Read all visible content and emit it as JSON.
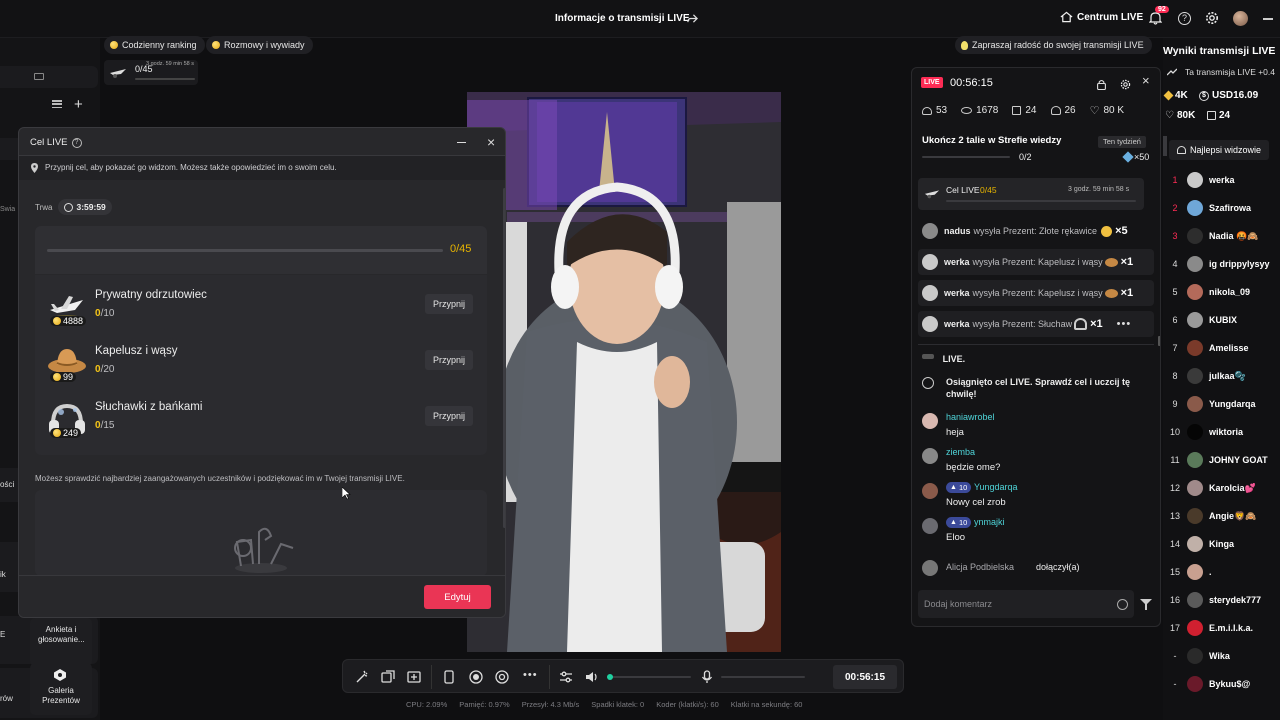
{
  "topbar": {
    "title": "Informacje o transmisji LIVE",
    "live_center": "Centrum LIVE",
    "notif_count": "92"
  },
  "chips": {
    "ranking": "Codzienny ranking",
    "interviews": "Rozmowy i wywiady",
    "invite": "Zapraszaj radość do swojej transmisji LIVE"
  },
  "mini_goal": {
    "progress": "0/45",
    "time": "3 godz. 59 min 58 s"
  },
  "left": {
    "partial_1": "Swia",
    "partial_2": "ości",
    "partial_3": "ik",
    "partial_4": "E",
    "partial_5": "rów",
    "poll_label": "Ankieta i głosowanie...",
    "gallery_label": "Galeria Prezentów"
  },
  "modal": {
    "title": "Cel LIVE",
    "info": "Przypnij cel, aby pokazać go widzom. Możesz także opowiedzieć im o swoim celu.",
    "duration_label": "Trwa",
    "duration_value": "3:59:59",
    "total_progress": "0/45",
    "gifts": [
      {
        "name": "Prywatny odrzutowiec",
        "price": "4888",
        "done": "0",
        "target": "/10",
        "pin": "Przypnij"
      },
      {
        "name": "Kapelusz i wąsy",
        "price": "99",
        "done": "0",
        "target": "/20",
        "pin": "Przypnij"
      },
      {
        "name": "Słuchawki z bańkami",
        "price": "249",
        "done": "0",
        "target": "/15",
        "pin": "Przypnij"
      }
    ],
    "footer_text": "Możesz sprawdzić najbardziej zaangażowanych uczestników i podziękować im w Twojej transmisji LIVE.",
    "edit_button": "Edytuj"
  },
  "panel": {
    "live_badge": "LIVE",
    "timer": "00:56:15",
    "stats": {
      "a": "53",
      "viewers": "1678",
      "c": "24",
      "d": "26",
      "likes": "80 K"
    },
    "quest_title": "Ukończ 2 talie w Strefie wiedzy",
    "quest_period": "Ten tydzień",
    "quest_progress": "0/2",
    "quest_reward": "×50",
    "goal_label": "Cel LIVE",
    "goal_progress": "0/45",
    "goal_time": "3 godz. 59 min 58 s",
    "gift_msgs": [
      {
        "user": "nadus",
        "text": "wysyła Prezent: Złote rękawice",
        "count": "×5"
      },
      {
        "user": "werka",
        "text": "wysyła Prezent: Kapelusz i wąsy",
        "count": "×1"
      },
      {
        "user": "werka",
        "text": "wysyła Prezent: Kapelusz i wąsy",
        "count": "×1"
      },
      {
        "user": "werka",
        "text": "wysyła Prezent: Słuchaw",
        "count": "×1"
      }
    ],
    "chat": {
      "cut_line": "LIVE.",
      "system_msg": "Osiągnięto cel LIVE. Sprawdź cel i uczcij tę chwilę!",
      "messages": [
        {
          "user": "haniawrobel",
          "text": "heja",
          "level": ""
        },
        {
          "user": "ziemba",
          "text": "będzie ome?",
          "level": ""
        },
        {
          "user": "Yungdarqa",
          "text": "Nowy cel zrob",
          "level": "10"
        },
        {
          "user": "ynmajki",
          "text": "Eloo",
          "level": "10"
        }
      ],
      "join_user": "Alicja Podbielska",
      "join_text": "dołączył(a)"
    },
    "comment_placeholder": "Dodaj komentarz"
  },
  "results": {
    "title": "Wyniki transmisji LIVE",
    "trend": "Ta transmisja LIVE +0.4",
    "diamonds": "4K",
    "usd": "USD16.09",
    "likes": "80K",
    "gifts": "24",
    "top_viewers_label": "Najlepsi widzowie",
    "viewers": [
      {
        "rank": "1",
        "name": "werka",
        "color": "#c9c9c9"
      },
      {
        "rank": "2",
        "name": "Szafirowa",
        "color": "#6fa7d8"
      },
      {
        "rank": "3",
        "name": "Nadia 🤬🙈",
        "color": "#2d2d2d"
      },
      {
        "rank": "4",
        "name": "ig drippylysyy",
        "color": "#8a8a8a"
      },
      {
        "rank": "5",
        "name": "nikola_09",
        "color": "#b46a5a"
      },
      {
        "rank": "6",
        "name": "KUBIX",
        "color": "#9a9a9a"
      },
      {
        "rank": "7",
        "name": "Amelisse",
        "color": "#7a3a2a"
      },
      {
        "rank": "8",
        "name": "julkaa🫧",
        "color": "#3a3a3a"
      },
      {
        "rank": "9",
        "name": "Yungdarqa",
        "color": "#8a5a4a"
      },
      {
        "rank": "10",
        "name": "wiktoria",
        "color": "#050505"
      },
      {
        "rank": "11",
        "name": "JOHNY GOAT",
        "color": "#5a7a5a"
      },
      {
        "rank": "12",
        "name": "Karolcia💕",
        "color": "#a08a8a"
      },
      {
        "rank": "13",
        "name": "Angie🦁🙈",
        "color": "#4a3a2a"
      },
      {
        "rank": "14",
        "name": "Kinga",
        "color": "#c0b0a8"
      },
      {
        "rank": "15",
        "name": ".",
        "color": "#c8a090"
      },
      {
        "rank": "16",
        "name": "sterydek777",
        "color": "#5a5a5a"
      },
      {
        "rank": "17",
        "name": "E.m.i.l.k.a.",
        "color": "#d02030"
      },
      {
        "rank": "-",
        "name": "Wika",
        "color": "#2a2a2a"
      },
      {
        "rank": "-",
        "name": "Bykuu$@",
        "color": "#6a1a2a"
      }
    ]
  },
  "controls": {
    "timer": "00:56:15"
  },
  "stats_bar": {
    "cpu": "CPU: 2.09%",
    "mem": "Pamięć: 0.97%",
    "bitrate": "Przesył: 4.3 Mb/s",
    "dropped": "Spadki klatek: 0",
    "encoder": "Koder (klatki/s): 60",
    "fps": "Klatki na sekundę: 60"
  }
}
